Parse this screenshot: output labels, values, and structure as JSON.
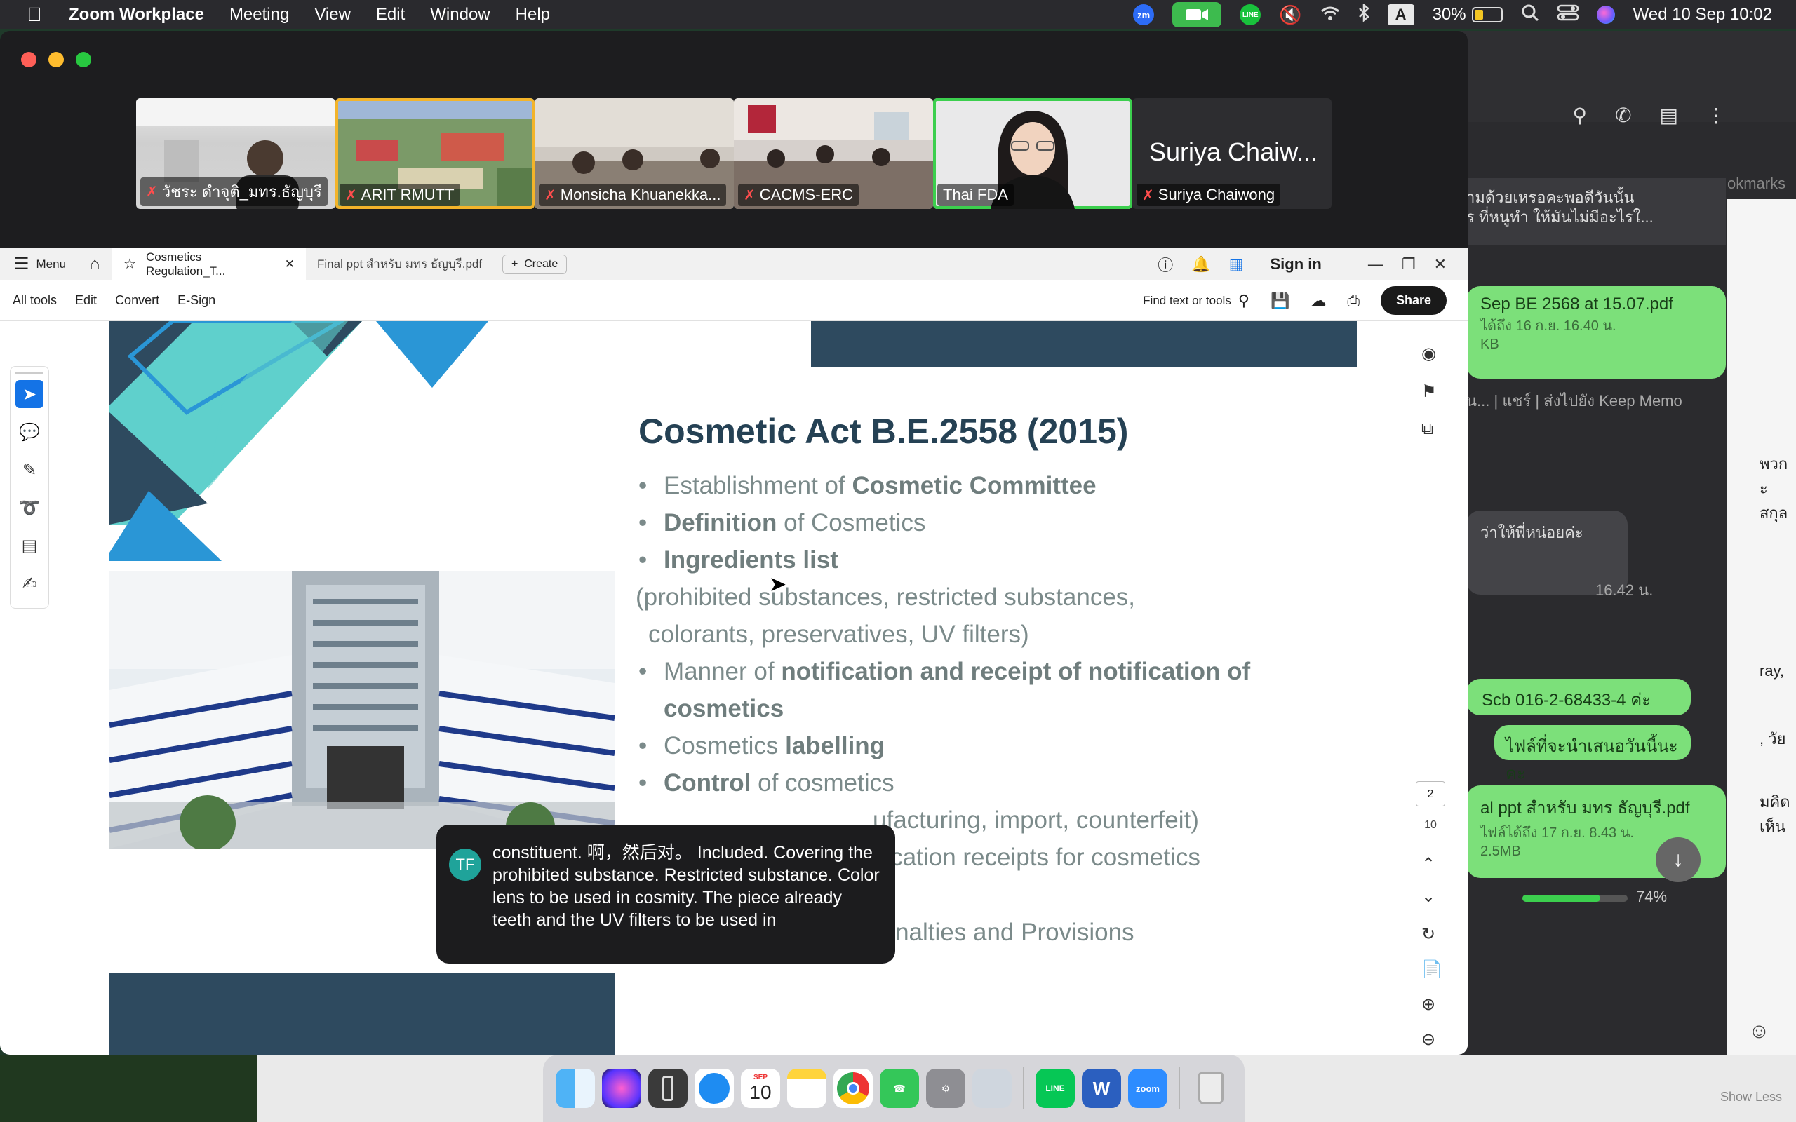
{
  "menubar": {
    "app_name": "Zoom Workplace",
    "menus": [
      "Meeting",
      "View",
      "Edit",
      "Window",
      "Help"
    ],
    "battery": "30%",
    "input_source": "A",
    "datetime": "Wed 10 Sep  10:02",
    "zoom_badge": "zm",
    "line_badge": "LINE"
  },
  "participants": [
    {
      "name": "วัชระ ดำจุติ_มทร.ธัญบุรี",
      "muted": true
    },
    {
      "name": "ARIT RMUTT",
      "muted": true
    },
    {
      "name": "Monsicha Khuanekka...",
      "muted": true
    },
    {
      "name": "CACMS-ERC",
      "muted": true
    },
    {
      "name": "Thai FDA",
      "muted": false,
      "active": true
    },
    {
      "name": "Suriya Chaiwong",
      "muted": true,
      "display_name": "Suriya Chaiw..."
    }
  ],
  "acrobat": {
    "menu_label": "Menu",
    "active_tab": "Cosmetics Regulation_T...",
    "inactive_tab": "Final ppt สำหรับ มทร ธัญบุรี.pdf",
    "create_label": "Create",
    "sign_in": "Sign in",
    "tools": [
      "All tools",
      "Edit",
      "Convert",
      "E-Sign"
    ],
    "find_label": "Find text or tools",
    "share_label": "Share",
    "current_page": "2",
    "total_pages": "10"
  },
  "slide": {
    "title": "Cosmetic Act B.E.2558 (2015)",
    "bullets": {
      "b1_pre": "Establishment of ",
      "b1_bold": "Cosmetic Committee",
      "b2_bold": "Definition",
      "b2_post": " of Cosmetics",
      "b3_bold": "Ingredients list",
      "b3_sub1": "(prohibited substances, restricted substances,",
      "b3_sub2": "colorants, preservatives, UV filters)",
      "b4_pre": "Manner of ",
      "b4_bold": "notification and receipt of notification of cosmetics",
      "b5_pre": "Cosmetics ",
      "b5_bold": "labelling",
      "b6_bold": "Control",
      "b6_post": " of cosmetics",
      "b6_sub": "ufacturing, import, counterfeit)",
      "b7_partial": "ification receipts for cosmetics",
      "b8": "Officials, Appeals, Penalties and Provisions"
    }
  },
  "caption": {
    "initials": "TF",
    "text": "constituent. 啊，然后对。 Included. Covering the prohibited substance. Restricted substance. Color lens to be used in cosmity. The piece already teeth and the UV filters to be used in"
  },
  "chat": {
    "preview_line1": "ามด้วยเหรอคะพอดีวันนั้น",
    "preview_line2": "ร ที่หนูทำ ให้มันไม่มีอะไรใ...",
    "bookmarks": "okmarks",
    "file1_name": "Sep BE 2568 at 15.07.pdf",
    "file1_meta": "ได้ถึง 16 ก.ย. 16.40 น.",
    "file1_size": "KB",
    "actions": "ัน... | แชร์ | ส่งไปยัง Keep Memo",
    "gray_msg": "ว่าให้พี่หน่อยค่ะ",
    "gray_time": "16.42 น.",
    "bank_msg": "Scb 016-2-68433-4  ค่ะ",
    "files_msg": "ไฟล์ที่จะนำเสนอวันนี้นะคะ",
    "file2_name": "al ppt สำหรับ มทร ธัญบุรี.pdf",
    "file2_meta": "ไฟล์ได้ถึง 17 ก.ย. 8.43 น.",
    "file2_size": "2.5MB",
    "progress": "74%",
    "side_text1": "พวก",
    "side_text2": "ะสกุล",
    "side_text3": "ray,",
    "side_text4": ", วัย",
    "side_text5": "มคิดเห็น"
  },
  "dock": {
    "calendar_month": "SEP",
    "calendar_day": "10",
    "show_less": "Show Less"
  },
  "colors": {
    "accent_green": "#3ccf4e",
    "slide_title": "#254154",
    "slide_body": "#7b8a8a",
    "caption_avatar": "#1fa39a"
  }
}
